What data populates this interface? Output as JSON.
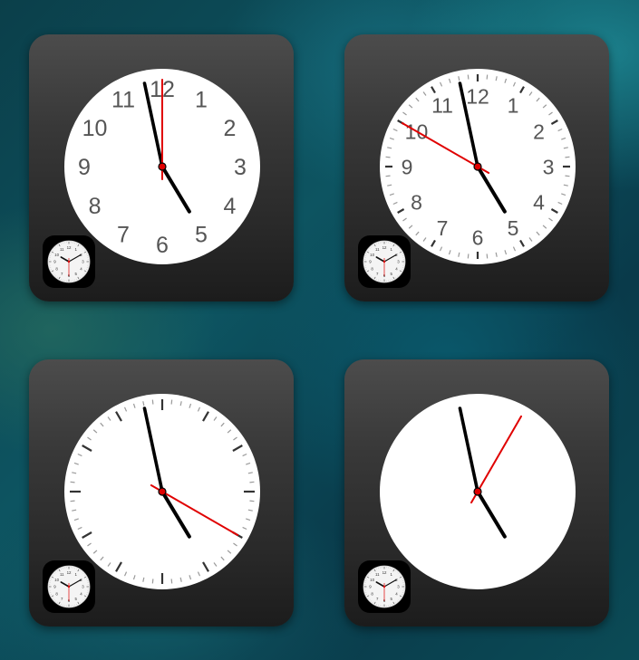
{
  "clock_numerals": [
    "12",
    "1",
    "2",
    "3",
    "4",
    "5",
    "6",
    "7",
    "8",
    "9",
    "10",
    "11"
  ],
  "tiles": [
    {
      "name": "clock-widget-numerals",
      "style": "numerals",
      "time": "4:58",
      "seconds_hand": "12"
    },
    {
      "name": "clock-widget-numerals-ticks",
      "style": "numerals-ticks",
      "time": "4:58",
      "seconds_hand": "10"
    },
    {
      "name": "clock-widget-ticks",
      "style": "ticks",
      "time": "4:58",
      "seconds_hand": "4"
    },
    {
      "name": "clock-widget-plain",
      "style": "plain",
      "time": "4:58",
      "seconds_hand": "1"
    }
  ],
  "app_icon": "clock-app-icon",
  "colors": {
    "tile_top": "#4c4c4c",
    "tile_bottom": "#1c1c1c",
    "face": "#ffffff",
    "hands": "#000000",
    "second_hand": "#e00000",
    "numerals": "#555555"
  }
}
